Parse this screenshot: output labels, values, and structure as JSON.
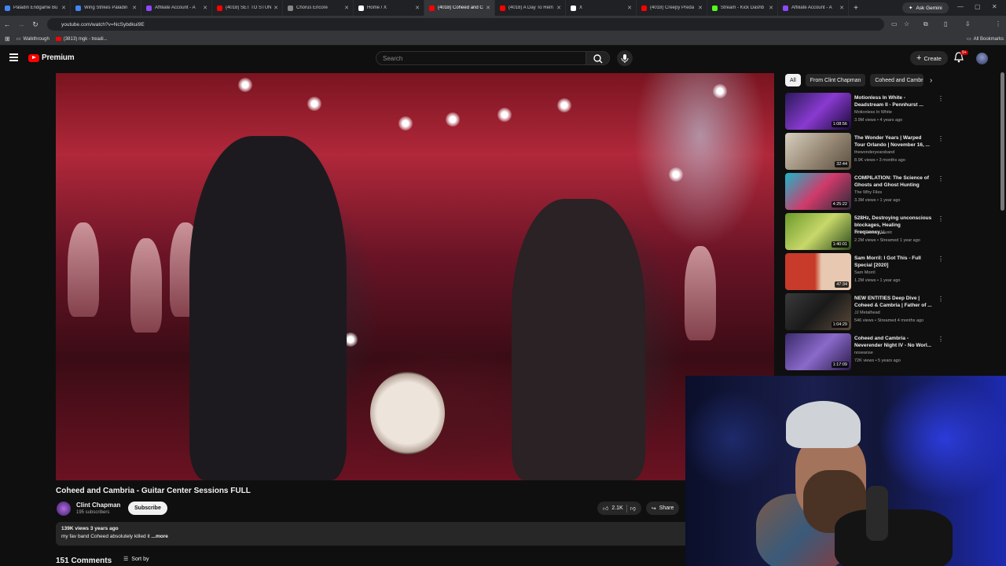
{
  "browser": {
    "tabs": [
      {
        "label": "Paladin Endgame Bu",
        "color": "#4285f4"
      },
      {
        "label": "Wing Strikes Paladin",
        "color": "#4285f4"
      },
      {
        "label": "Affiliate Account - A",
        "color": "#9146ff"
      },
      {
        "label": "(4018) SET TO STUN",
        "color": "#ff0000"
      },
      {
        "label": "Chorus Encore",
        "color": "#888888"
      },
      {
        "label": "Home / X",
        "color": "#ffffff"
      },
      {
        "label": "(4018) Coheed and C",
        "color": "#ff0000"
      },
      {
        "label": "(4018) A Day To Rem",
        "color": "#ff0000"
      },
      {
        "label": "X",
        "color": "#ffffff"
      },
      {
        "label": "(4018) Creepy Preda",
        "color": "#ff0000"
      },
      {
        "label": "Stream - Kick Dashb",
        "color": "#53fc18"
      },
      {
        "label": "Affiliate Account - A",
        "color": "#9146ff"
      }
    ],
    "gemini_label": "Ask Gemini",
    "url": "youtube.com/watch?v=NcSybdkui9E",
    "bookmarks": [
      {
        "label": "Walkthrough"
      },
      {
        "label": "(3813) mgk - treadi..."
      }
    ],
    "all_bookmarks": "All Bookmarks"
  },
  "youtube": {
    "brand": "Premium",
    "search_placeholder": "Search",
    "create_label": "Create",
    "notif_badge": "9+"
  },
  "video": {
    "title": "Coheed and Cambria - Guitar Center Sessions FULL",
    "channel": "Clint Chapman",
    "subscribers": "195 subscribers",
    "subscribe_label": "Subscribe",
    "likes": "2.1K",
    "share_label": "Share",
    "views_date": "139K views  3 years ago",
    "description": "my fav band Coheed absolutely killed it ",
    "more_label": "...more",
    "comments_count": "151 Comments",
    "sort_label": "Sort by"
  },
  "chips": [
    "All",
    "From Clint Chapman",
    "Coheed and Cambria"
  ],
  "recommendations": [
    {
      "title": "Motionless In White - Deadstream II - Pennhurst ...",
      "channel": "Motionless In White",
      "meta": "3.9M views • 4 years ago",
      "duration": "1:08:56",
      "thumb": "linear-gradient(135deg,#2a1a5a,#8a3ad0,#1a0a3a)"
    },
    {
      "title": "The Wonder Years | Warped Tour Orlando | November 16, ...",
      "channel": "thewonderyearsband",
      "meta": "8.9K views • 3 months ago",
      "duration": "32:44",
      "thumb": "linear-gradient(135deg,#d8cfc0,#9a8c78,#5a4e40)"
    },
    {
      "title": "COMPILATION: The Science of Ghosts and Ghost Hunting",
      "channel": "The Why Files",
      "meta": "3.3M views • 1 year ago",
      "duration": "4:25:22",
      "thumb": "linear-gradient(135deg,#1fb5c8,#d03a6a,#2a2a3a)"
    },
    {
      "title": "528Hz, Destroying unconscious blockages, Healing Frequency,...",
      "channel": "Inner Peaces Music",
      "meta": "2.2M views • Streamed 1 year ago",
      "duration": "1:40:01",
      "thumb": "linear-gradient(135deg,#6a9a2a,#c8d86a,#2a4a1a)"
    },
    {
      "title": "Sam Morril: I Got This - Full Special [2020]",
      "channel": "Sam Morril",
      "meta": "1.2M views • 1 year ago",
      "duration": "47:34",
      "thumb": "linear-gradient(90deg,#c83a2a 45%,#e8c8b0 55%)"
    },
    {
      "title": "NEW ENTITIES Deep Dive | Coheed & Cambria | Father of ...",
      "channel": "JJ Metalhead",
      "meta": "546 views • Streamed 4 months ago",
      "duration": "1:04:29",
      "thumb": "linear-gradient(135deg,#3a3a3a,#1a1a1a,#5a4a3a)"
    },
    {
      "title": "Coheed and Cambria - Neverender Night IV - No Worl...",
      "channel": "noseanse",
      "meta": "72K views • 5 years ago",
      "duration": "1:17:09",
      "thumb": "linear-gradient(135deg,#3a2a6a,#8a6aca,#2a1a4a)"
    }
  ]
}
